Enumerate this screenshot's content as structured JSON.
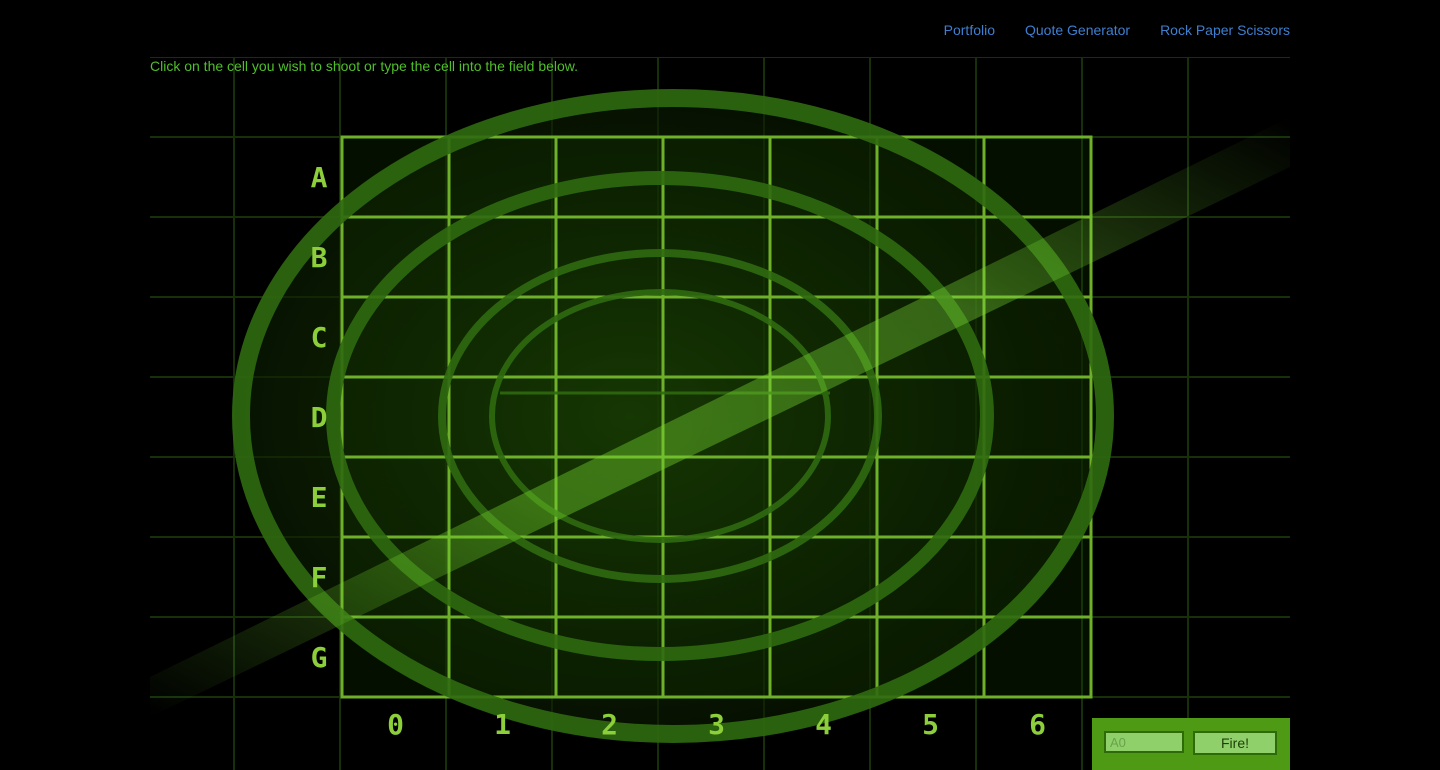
{
  "nav": {
    "links": [
      {
        "label": "Portfolio"
      },
      {
        "label": "Quote Generator"
      },
      {
        "label": "Rock Paper Scissors"
      }
    ]
  },
  "instructions": "Click on the cell you wish to shoot or type the cell into the field below.",
  "board": {
    "rows": [
      "A",
      "B",
      "C",
      "D",
      "E",
      "F",
      "G"
    ],
    "columns": [
      "0",
      "1",
      "2",
      "3",
      "4",
      "5",
      "6"
    ]
  },
  "controls": {
    "input_placeholder": "A0",
    "fire_label": "Fire!"
  },
  "colors": {
    "background": "#000000",
    "grid": "#6fb02b",
    "radar_ring": "#2f6a10",
    "sweep": "#6fcf2a",
    "link": "#3f7fd0",
    "panel": "#4e9a14"
  }
}
